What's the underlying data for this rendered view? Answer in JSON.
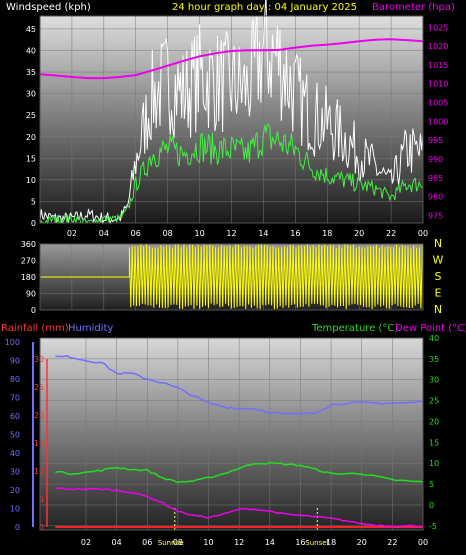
{
  "header": {
    "left": "Windspeed (kph)",
    "center": "24 hour graph day : 04 January 2025",
    "right": "Barometer (hpa)"
  },
  "colors": {
    "bg": "#000000",
    "wind": "#ffffff",
    "gust": "#e0e0e0",
    "avg": "#44ee44",
    "baro": "#ee00ee",
    "dir": "#ffff00",
    "rain_axis": "#ff3333",
    "humidity": "#7070ff",
    "temperature": "#22dd22",
    "dewpoint": "#ee00ee",
    "sun": "#ffff66",
    "grid": "#777777"
  },
  "chart_data": [
    {
      "type": "line",
      "name": "wind-barometer",
      "x_ticks": [
        "02",
        "04",
        "06",
        "08",
        "10",
        "12",
        "14",
        "16",
        "18",
        "20",
        "22",
        "00"
      ],
      "x_range_hours": [
        0,
        24
      ],
      "y_left_ticks": [
        0,
        5,
        10,
        15,
        20,
        25,
        30,
        35,
        40,
        45
      ],
      "y_left_range": [
        0,
        48
      ],
      "y_right_ticks": [
        975,
        980,
        985,
        990,
        995,
        1000,
        1005,
        1010,
        1015,
        1020,
        1025
      ],
      "y_right_range": [
        973,
        1028
      ],
      "series": [
        {
          "name": "Windspeed",
          "x": [
            0,
            1,
            2,
            3,
            4,
            5,
            5.5,
            6,
            6.5,
            7,
            8,
            9,
            10,
            11,
            12,
            13,
            14,
            15,
            16,
            17,
            18,
            19,
            20,
            21,
            22,
            23,
            24
          ],
          "values": [
            2,
            1,
            1,
            2,
            1,
            1,
            4,
            14,
            22,
            29,
            33,
            30,
            34,
            33,
            32,
            31,
            40,
            38,
            30,
            25,
            23,
            20,
            16,
            13,
            9,
            17,
            16
          ]
        },
        {
          "name": "Average",
          "x": [
            0,
            1,
            2,
            3,
            4,
            5,
            5.5,
            6,
            6.5,
            7,
            8,
            9,
            10,
            11,
            12,
            13,
            14,
            15,
            16,
            17,
            18,
            19,
            20,
            21,
            22,
            23,
            24
          ],
          "values": [
            0,
            1,
            1,
            0,
            1,
            1,
            3,
            9,
            12,
            16,
            17,
            16,
            18,
            17,
            17,
            16,
            20,
            19,
            17,
            13,
            11,
            10,
            9,
            8,
            6,
            9,
            9
          ]
        },
        {
          "name": "Barometer",
          "x": [
            0,
            1,
            2,
            3,
            4,
            5,
            6,
            7,
            8,
            9,
            10,
            11,
            12,
            13,
            14,
            15,
            16,
            17,
            18,
            19,
            20,
            21,
            22,
            23,
            24
          ],
          "values": [
            1012.5,
            1012.2,
            1011.8,
            1011.5,
            1011.5,
            1011.8,
            1012.3,
            1013.5,
            1014.8,
            1016.1,
            1017.3,
            1018.1,
            1018.7,
            1018.9,
            1018.9,
            1019.0,
            1019.6,
            1020.1,
            1020.4,
            1020.8,
            1021.3,
            1021.7,
            1021.8,
            1021.6,
            1021.3
          ]
        }
      ]
    },
    {
      "type": "line",
      "name": "wind-direction",
      "y_left_ticks": [
        0,
        90,
        180,
        270,
        360
      ],
      "y_range": [
        0,
        360
      ],
      "y_right_labels": [
        "N",
        "W",
        "S",
        "E",
        "N"
      ],
      "series": [
        {
          "name": "Direction",
          "x": [
            0,
            5.6
          ],
          "values": [
            180,
            180
          ]
        }
      ],
      "note_shape": "oscillating 0-360 after 05:36"
    },
    {
      "type": "line",
      "name": "temp-humidity",
      "x_ticks": [
        "02",
        "04",
        "06",
        "08",
        "10",
        "12",
        "14",
        "16",
        "18",
        "20",
        "22",
        "00"
      ],
      "x_range_hours": [
        -1,
        24
      ],
      "y_humidity_ticks": [
        0,
        10,
        20,
        30,
        40,
        50,
        60,
        70,
        80,
        90,
        100
      ],
      "y_rain_ticks": [
        0,
        5,
        10,
        15,
        20,
        25,
        30
      ],
      "y_rain_range": [
        0,
        33
      ],
      "y_temp_ticks": [
        -5,
        0,
        5,
        10,
        15,
        20,
        25,
        30,
        35,
        40
      ],
      "y_temp_range": [
        -6,
        40
      ],
      "labels": {
        "rainfall": "Rainfall (mm)",
        "humidity": "Humidity",
        "temperature": "Temperature (°C)",
        "dewpoint": "Dew Point (°C)",
        "sunrise": "Sunrise",
        "sunset": "Sunset"
      },
      "sun": {
        "sunrise_hour": 7.8,
        "sunset_hour": 17.1
      },
      "series": [
        {
          "name": "Humidity",
          "x": [
            0,
            1,
            2,
            3,
            4,
            5,
            6,
            7,
            8,
            9,
            10,
            11,
            12,
            13,
            14,
            15,
            16,
            17,
            18,
            19,
            20,
            21,
            22,
            23,
            24
          ],
          "values": [
            92,
            92,
            90,
            89,
            83,
            83,
            80,
            78,
            75,
            71,
            67,
            65,
            64,
            64,
            62,
            61,
            61,
            62,
            66,
            67,
            67,
            67,
            67,
            67,
            68
          ]
        },
        {
          "name": "Temperature",
          "x": [
            0,
            1,
            2,
            3,
            4,
            5,
            6,
            7,
            8,
            9,
            10,
            11,
            12,
            13,
            14,
            15,
            16,
            17,
            18,
            19,
            20,
            21,
            22,
            23,
            24
          ],
          "values": [
            8.0,
            7.5,
            7.8,
            8.3,
            9.0,
            8.5,
            8.3,
            6.5,
            5.5,
            5.7,
            6.5,
            7.5,
            8.8,
            10.0,
            10.0,
            9.8,
            9.5,
            8.5,
            7.5,
            7.5,
            7.5,
            6.8,
            6.0,
            5.7,
            5.5
          ]
        },
        {
          "name": "Dew Point",
          "x": [
            0,
            1,
            2,
            3,
            4,
            5,
            6,
            7,
            8,
            9,
            10,
            11,
            12,
            13,
            14,
            15,
            16,
            17,
            18,
            19,
            20,
            21,
            22,
            23,
            24
          ],
          "values": [
            4.0,
            3.8,
            3.8,
            3.8,
            3.5,
            3.0,
            2.0,
            0.5,
            -1.5,
            -2.5,
            -3.0,
            -2.2,
            -1.0,
            -1.0,
            -1.5,
            -2.2,
            -2.5,
            -2.8,
            -3.2,
            -3.8,
            -4.5,
            -4.9,
            -5.0,
            -5.0,
            -5.0
          ]
        },
        {
          "name": "Rainfall",
          "x": [
            0,
            24
          ],
          "values": [
            0,
            0
          ]
        }
      ]
    }
  ]
}
